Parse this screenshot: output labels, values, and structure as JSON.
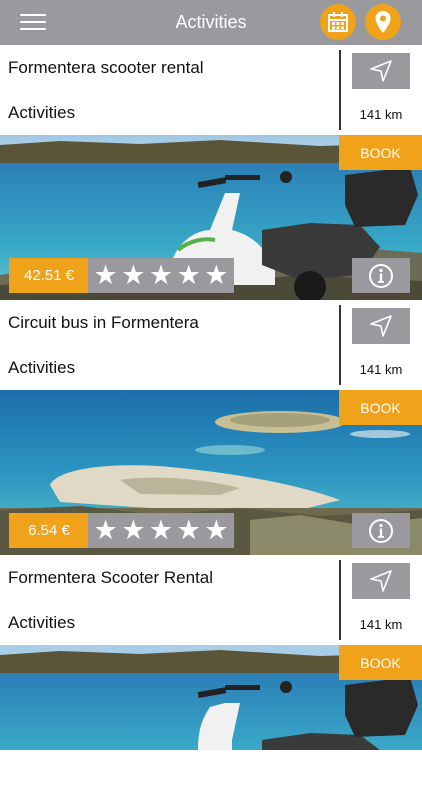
{
  "header": {
    "title": "Activities",
    "menu_icon": "hamburger-menu-icon",
    "calendar_icon": "calendar-icon",
    "location_icon": "map-pin-icon"
  },
  "colors": {
    "accent": "#f0a21b",
    "gray": "#9a9a9e"
  },
  "listings": [
    {
      "name": "Formentera scooter rental",
      "category": "Activities",
      "distance": "141 km",
      "book_label": "BOOK",
      "price": "42.51 €",
      "stars": "★★★★★",
      "rating_out_of_5": 5,
      "image": "scooter-coast-photo"
    },
    {
      "name": "Circuit bus in Formentera",
      "category": "Activities",
      "distance": "141 km",
      "book_label": "BOOK",
      "price": "6.54 €",
      "stars": "★★★★★",
      "rating_out_of_5": 5,
      "image": "beach-island-photo"
    },
    {
      "name": "Formentera Scooter Rental",
      "category": "Activities",
      "distance": "141 km",
      "book_label": "BOOK",
      "price": "",
      "stars": "",
      "image": "scooter-coast-photo"
    }
  ]
}
